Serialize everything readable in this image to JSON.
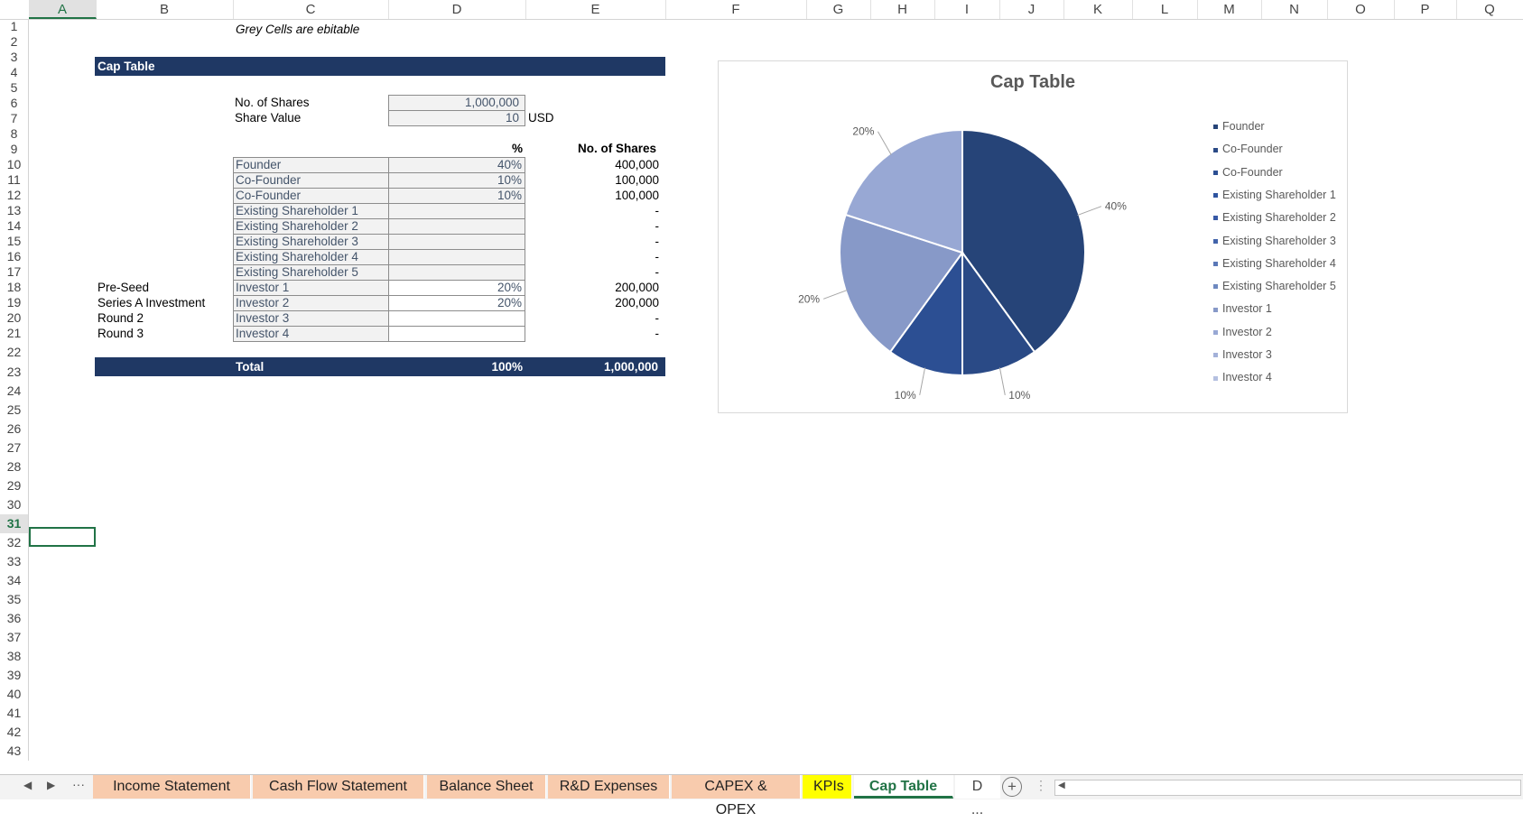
{
  "columns": [
    "A",
    "B",
    "C",
    "D",
    "E",
    "F",
    "G",
    "H",
    "I",
    "J",
    "K",
    "L",
    "M",
    "N",
    "O",
    "P",
    "Q"
  ],
  "rows": [
    "1",
    "2",
    "3",
    "4",
    "5",
    "6",
    "7",
    "8",
    "9",
    "10",
    "11",
    "12",
    "13",
    "14",
    "15",
    "16",
    "17",
    "18",
    "19",
    "20",
    "21",
    "22",
    "23",
    "24",
    "25",
    "26",
    "27",
    "28",
    "29",
    "30",
    "31",
    "32",
    "33",
    "34",
    "35",
    "36",
    "37",
    "38",
    "39",
    "40",
    "41",
    "42",
    "43"
  ],
  "note": "Grey Cells are ebitable",
  "section_title": "Cap Table",
  "shares_label": "No. of Shares",
  "shares_value": "1,000,000",
  "share_value_label": "Share Value",
  "share_value": "10",
  "currency": "USD",
  "col_pct": "%",
  "col_shares": "No. of Shares",
  "holders": [
    {
      "round": "",
      "name": "Founder",
      "pct": "40%",
      "shares": "400,000"
    },
    {
      "round": "",
      "name": "Co-Founder",
      "pct": "10%",
      "shares": "100,000"
    },
    {
      "round": "",
      "name": "Co-Founder",
      "pct": "10%",
      "shares": "100,000"
    },
    {
      "round": "",
      "name": "Existing Shareholder 1",
      "pct": "",
      "shares": "-"
    },
    {
      "round": "",
      "name": "Existing Shareholder 2",
      "pct": "",
      "shares": "-"
    },
    {
      "round": "",
      "name": "Existing Shareholder 3",
      "pct": "",
      "shares": "-"
    },
    {
      "round": "",
      "name": "Existing Shareholder 4",
      "pct": "",
      "shares": "-"
    },
    {
      "round": "",
      "name": "Existing Shareholder 5",
      "pct": "",
      "shares": "-"
    },
    {
      "round": "Pre-Seed",
      "name": "Investor 1",
      "pct": "20%",
      "shares": "200,000"
    },
    {
      "round": "Series A Investment",
      "name": "Investor 2",
      "pct": "20%",
      "shares": "200,000"
    },
    {
      "round": "Round 2",
      "name": "Investor 3",
      "pct": "",
      "shares": "-"
    },
    {
      "round": "Round 3",
      "name": "Investor 4",
      "pct": "",
      "shares": "-"
    }
  ],
  "total": {
    "label": "Total",
    "pct": "100%",
    "shares": "1,000,000"
  },
  "tabs": [
    "Income Statement",
    "Cash Flow Statement",
    "Balance Sheet",
    "R&D Expenses",
    "CAPEX & OPEX",
    "KPIs",
    "Cap Table",
    "D ..."
  ],
  "chart_data": {
    "type": "pie",
    "title": "Cap Table",
    "categories": [
      "Founder",
      "Co-Founder",
      "Co-Founder",
      "Existing Shareholder 1",
      "Existing Shareholder 2",
      "Existing Shareholder 3",
      "Existing Shareholder 4",
      "Existing Shareholder 5",
      "Investor 1",
      "Investor 2",
      "Investor 3",
      "Investor 4"
    ],
    "values": [
      40,
      10,
      10,
      0,
      0,
      0,
      0,
      0,
      20,
      20,
      0,
      0
    ],
    "data_labels": [
      "40%",
      "10%",
      "10%",
      "",
      "",
      "",
      "",
      "",
      "20%",
      "20%",
      "",
      ""
    ],
    "colors": [
      "#264478",
      "#2a4a86",
      "#2c4f93",
      "#2e54a0",
      "#3759a6",
      "#4264ab",
      "#5a78b7",
      "#6e89c0",
      "#8799c8",
      "#98a8d4",
      "#a3b1d9",
      "#b4c0e0"
    ],
    "legend": "right"
  }
}
